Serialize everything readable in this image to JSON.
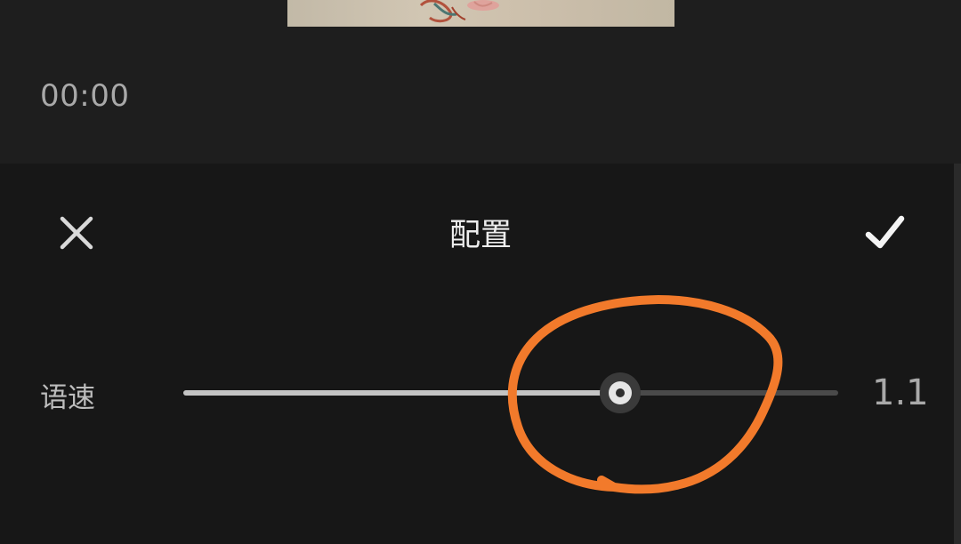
{
  "preview": {
    "timecode": "00:00"
  },
  "panel": {
    "title": "配置",
    "close_icon": "close-icon",
    "confirm_icon": "checkmark-icon"
  },
  "speed": {
    "label": "语速",
    "value_text": "1.1",
    "slider_fraction": 0.667
  },
  "colors": {
    "annotation": "#f27a2b",
    "panel_background": "#171717",
    "slider_fill": "#c4c4c4",
    "slider_track": "#4a4a4a"
  }
}
